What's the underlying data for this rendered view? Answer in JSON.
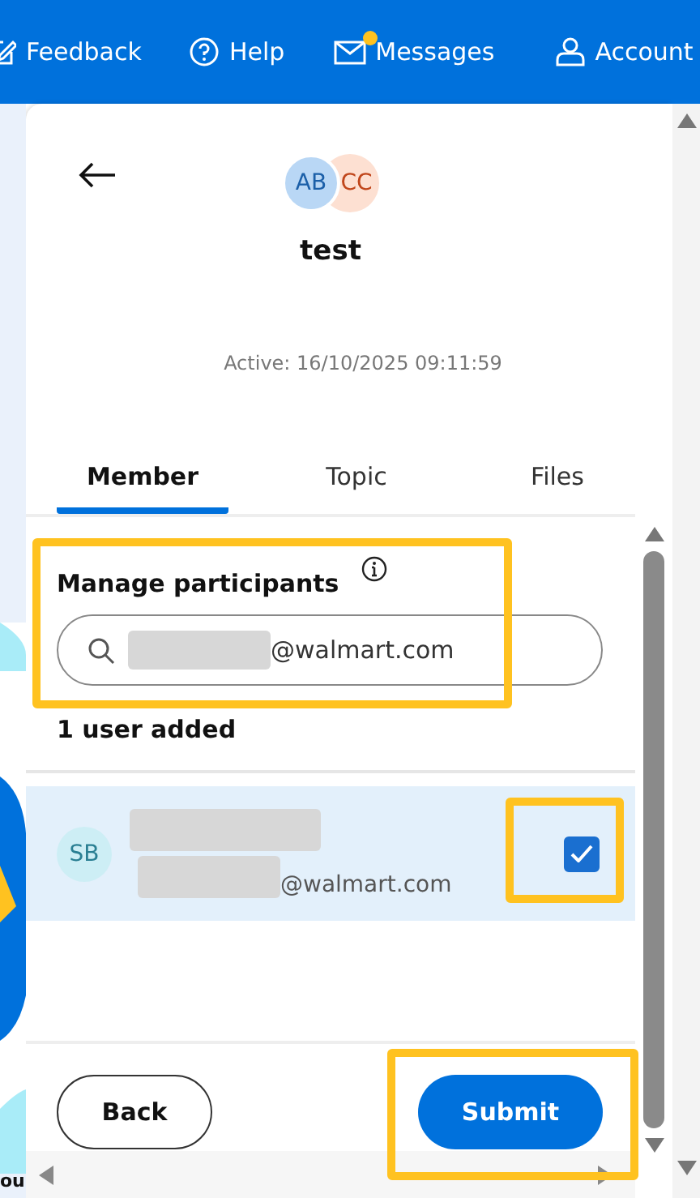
{
  "header": {
    "nav": [
      {
        "label": "Feedback",
        "notification": false
      },
      {
        "label": "Help",
        "notification": false
      },
      {
        "label": "Messages",
        "notification": true
      },
      {
        "label": "Account",
        "notification": false
      }
    ]
  },
  "background": {
    "text_fragment": "ou"
  },
  "conversation": {
    "avatars": [
      "AB",
      "CC"
    ],
    "title": "test",
    "active": "Active: 16/10/2025 09:11:59",
    "tabs": [
      {
        "label": "Member",
        "selected": true
      },
      {
        "label": "Topic",
        "selected": false
      },
      {
        "label": "Files",
        "selected": false
      }
    ],
    "participants": {
      "label": "Manage participants",
      "search_value": "@walmart.com",
      "count": "1 user added",
      "users": [
        {
          "initials": "SB",
          "email": "@walmart.com",
          "checked": true
        }
      ]
    },
    "buttons": {
      "back": "Back",
      "submit": "Submit"
    }
  }
}
